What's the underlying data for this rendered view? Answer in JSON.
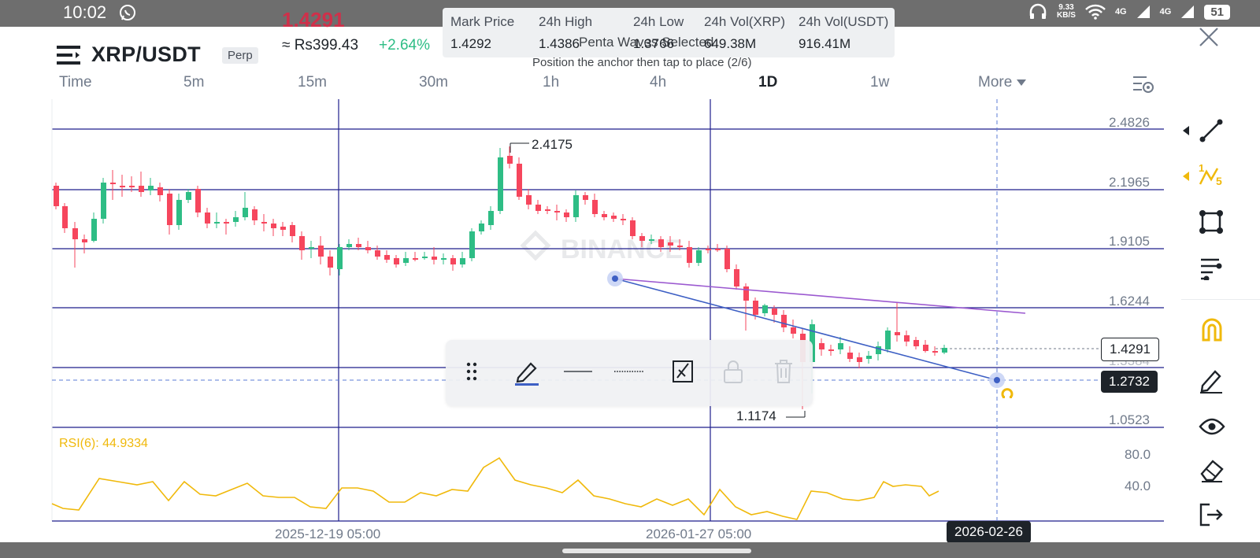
{
  "status_bar": {
    "time": "10:02",
    "net_speed_value": "9.33",
    "net_speed_unit": "KB/S",
    "signal1": "4G",
    "signal2": "4G",
    "battery": "51"
  },
  "header": {
    "pair": "XRP/USDT",
    "contract_type": "Perp",
    "last_price": "1.4291",
    "local_price": "≈ Rs399.43",
    "change_percent": "+2.64%",
    "last_price_color": "#cf304a",
    "change_color": "#2ebd85"
  },
  "stats": [
    {
      "label": "Mark Price",
      "value": "1.4292"
    },
    {
      "label": "24h High",
      "value": "1.4386"
    },
    {
      "label": "24h Low",
      "value": "1.3766"
    },
    {
      "label": "24h Vol(XRP)",
      "value": "649.38M"
    },
    {
      "label": "24h Vol(USDT)",
      "value": "916.41M"
    }
  ],
  "toast": {
    "title": "Penta Waves Selected",
    "subtitle": "Position the anchor then tap to place (2/6)"
  },
  "timeframes": [
    "Time",
    "5m",
    "15m",
    "30m",
    "1h",
    "4h",
    "1D",
    "1w",
    "More"
  ],
  "active_timeframe": "1D",
  "chart": {
    "watermark": "BINANCE",
    "price_levels": [
      "2.4826",
      "2.1965",
      "1.9105",
      "1.6244",
      "1.3384",
      "1.0523"
    ],
    "current_price": "1.4291",
    "cursor_price": "1.2732",
    "high_label": "2.4175",
    "low_label": "1.1174",
    "rsi_label": "RSI(6): 44.9334",
    "rsi_levels": [
      "80.0",
      "40.0"
    ],
    "dates": [
      "2025-12-19 05:00",
      "2026-01-27 05:00"
    ],
    "cursor_date": "2026-02-26",
    "up_color": "#2ebd85",
    "down_color": "#f6465d",
    "line_color": "#1e1e8c",
    "rsi_color": "#f0b90b"
  },
  "drawing_toolbar": {
    "items": [
      "drag-handle-icon",
      "pencil-icon",
      "solid-line-icon",
      "dotted-line-icon",
      "hide-drawings-icon",
      "lock-icon",
      "trash-icon"
    ]
  },
  "tools": {
    "items": [
      "trend-line-icon",
      "penta-waves-icon",
      "rectangle-icon",
      "fib-tools-icon",
      "magnet-icon",
      "brush-icon",
      "eye-icon",
      "eraser-icon",
      "exit-icon"
    ],
    "wave_sub": "5",
    "wave_main": "1"
  }
}
